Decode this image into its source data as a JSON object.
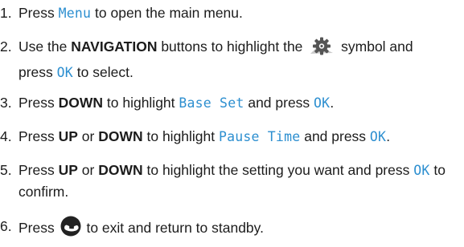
{
  "steps": [
    {
      "number": "1.",
      "t1": "Press ",
      "key": "Menu",
      "t2": " to open the main menu."
    },
    {
      "number": "2.",
      "t1": "Use the ",
      "bold": "NAVIGATION",
      "t2": " buttons to highlight the ",
      "icon": "settings-gear-icon",
      "t3": " symbol and press ",
      "key": "OK",
      "t4": " to select."
    },
    {
      "number": "3.",
      "t1": "Press ",
      "bold": "DOWN",
      "t2": " to highlight ",
      "key1": "Base Set",
      "t3": " and press ",
      "key2": "OK",
      "t4": "."
    },
    {
      "number": "4.",
      "t1": "Press ",
      "bold1": "UP",
      "t2": " or ",
      "bold2": "DOWN",
      "t3": " to highlight ",
      "key1": "Pause Time",
      "t4": " and press ",
      "key2": "OK",
      "t5": "."
    },
    {
      "number": "5.",
      "t1": "Press ",
      "bold1": "UP",
      "t2": " or ",
      "bold2": "DOWN",
      "t3": " to highlight the setting you want and press ",
      "key": "OK",
      "t4": " to confirm."
    },
    {
      "number": "6.",
      "t1": "Press ",
      "icon": "end-call-icon",
      "t2": " to exit and return to standby."
    }
  ],
  "colors": {
    "text": "#1c1c1c",
    "lcd_text": "#2d8fd0",
    "end_call_icon": "#222222"
  }
}
